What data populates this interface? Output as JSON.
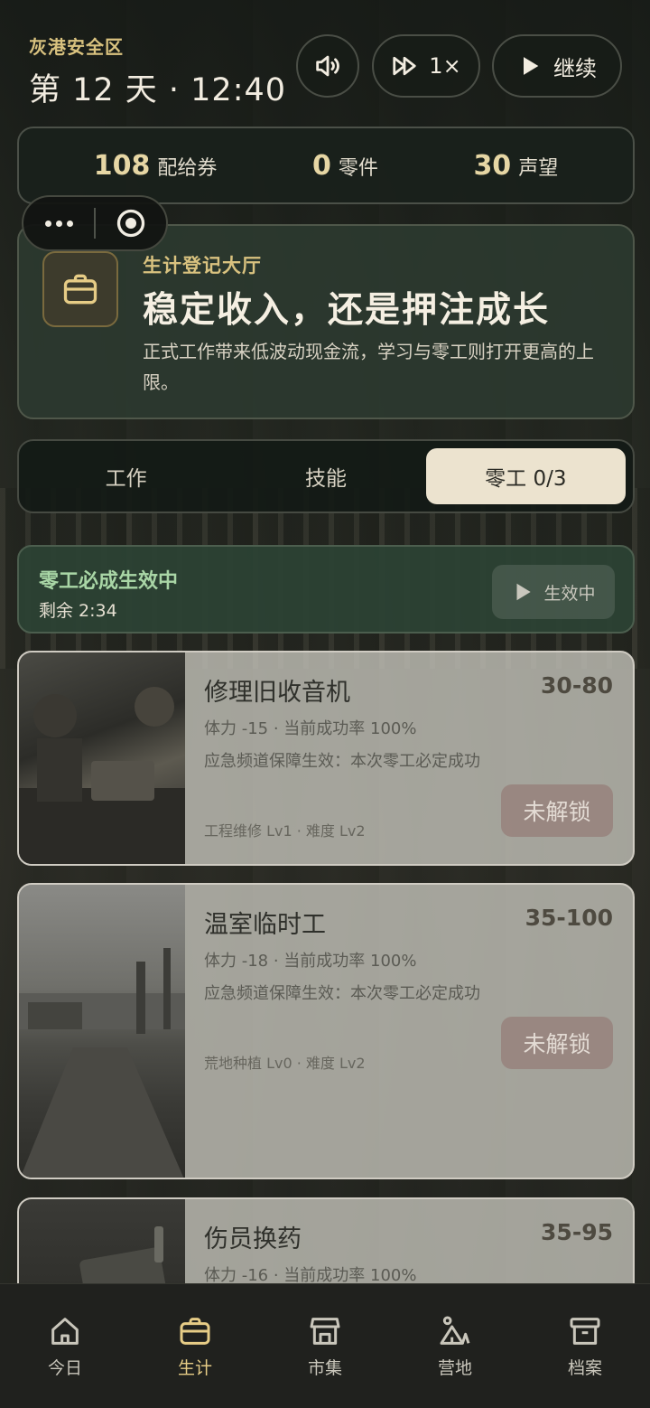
{
  "header": {
    "zone": "灰港安全区",
    "daytime": "第 12 天 · 12:40",
    "speed_label": "1×",
    "continue_label": "继续"
  },
  "resources": [
    {
      "value": "108",
      "label": "配给券"
    },
    {
      "value": "0",
      "label": "零件"
    },
    {
      "value": "30",
      "label": "声望"
    }
  ],
  "hero": {
    "kicker": "生计登记大厅",
    "title": "稳定收入，还是押注成长",
    "description": "正式工作带来低波动现金流，学习与零工则打开更高的上限。"
  },
  "tabs": [
    {
      "label": "工作",
      "active": false
    },
    {
      "label": "技能",
      "active": false
    },
    {
      "label": "零工 0/3",
      "active": true
    }
  ],
  "banner": {
    "title": "零工必成生效中",
    "remaining": "剩余 2:34",
    "button_label": "生效中"
  },
  "jobs": [
    {
      "name": "修理旧收音机",
      "pay": "30-80",
      "stamina_line": "体力 -15 · 当前成功率 100%",
      "note": "应急频道保障生效：本次零工必定成功",
      "tags": "工程维修 Lv1 · 难度 Lv2",
      "button": "未解锁"
    },
    {
      "name": "温室临时工",
      "pay": "35-100",
      "stamina_line": "体力 -18 · 当前成功率 100%",
      "note": "应急频道保障生效：本次零工必定成功",
      "tags": "荒地种植 Lv0 · 难度 Lv2",
      "button": "未解锁"
    },
    {
      "name": "伤员换药",
      "pay": "35-95",
      "stamina_line": "体力 -16 · 当前成功率 100%"
    }
  ],
  "nav": [
    {
      "label": "今日",
      "icon": "home-icon",
      "active": false
    },
    {
      "label": "生计",
      "icon": "briefcase-icon",
      "active": true
    },
    {
      "label": "市集",
      "icon": "store-icon",
      "active": false
    },
    {
      "label": "营地",
      "icon": "camp-icon",
      "active": false
    },
    {
      "label": "档案",
      "icon": "archive-icon",
      "active": false
    }
  ],
  "colors": {
    "accent_gold": "#d9c27f",
    "active_tab_bg": "#ece3cf",
    "banner_green": "#a9d6a6"
  }
}
